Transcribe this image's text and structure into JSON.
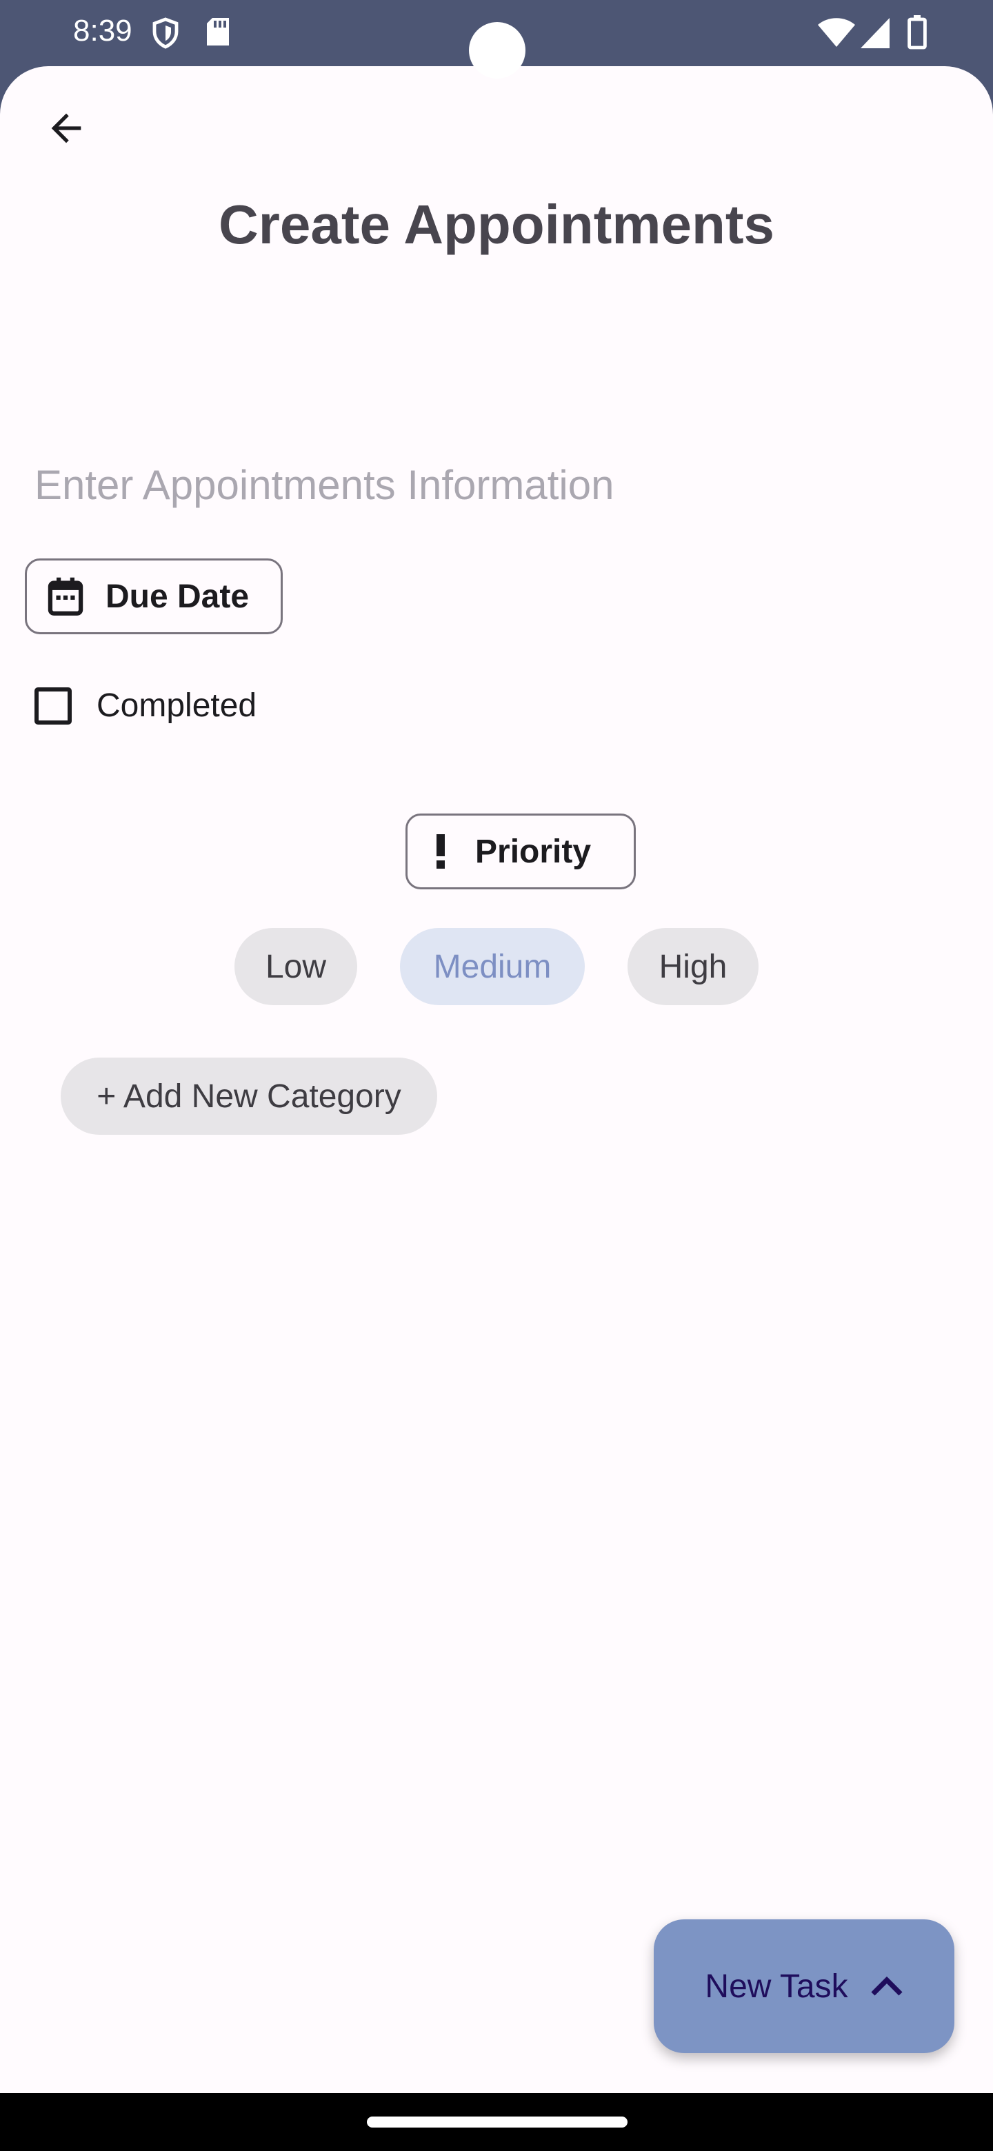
{
  "status_bar": {
    "time": "8:39",
    "icons": [
      "shield-icon",
      "sd-card-icon",
      "wifi-icon",
      "signal-icon",
      "battery-icon"
    ]
  },
  "header": {
    "back_icon": "arrow-left-icon",
    "title": "Create Appointments"
  },
  "form": {
    "info_placeholder": "Enter Appointments Information",
    "info_value": "",
    "due_date": {
      "icon": "calendar-icon",
      "label": "Due Date"
    },
    "completed": {
      "label": "Completed",
      "checked": false
    },
    "priority": {
      "icon": "exclamation-icon",
      "label": "Priority",
      "options": [
        "Low",
        "Medium",
        "High"
      ],
      "selected": "Medium"
    },
    "add_category_label": "+ Add New Category"
  },
  "fab": {
    "label": "New Task",
    "icon": "chevron-up-icon"
  },
  "colors": {
    "status_bar": "#4d5674",
    "background": "#fffbfe",
    "fab": "#7d94c4",
    "fab_text": "#1f0d5c",
    "chip": "#e7e5e8",
    "chip_selected_bg": "#dfe5f3",
    "chip_selected_text": "#7d8fc3",
    "title": "#48454e"
  }
}
